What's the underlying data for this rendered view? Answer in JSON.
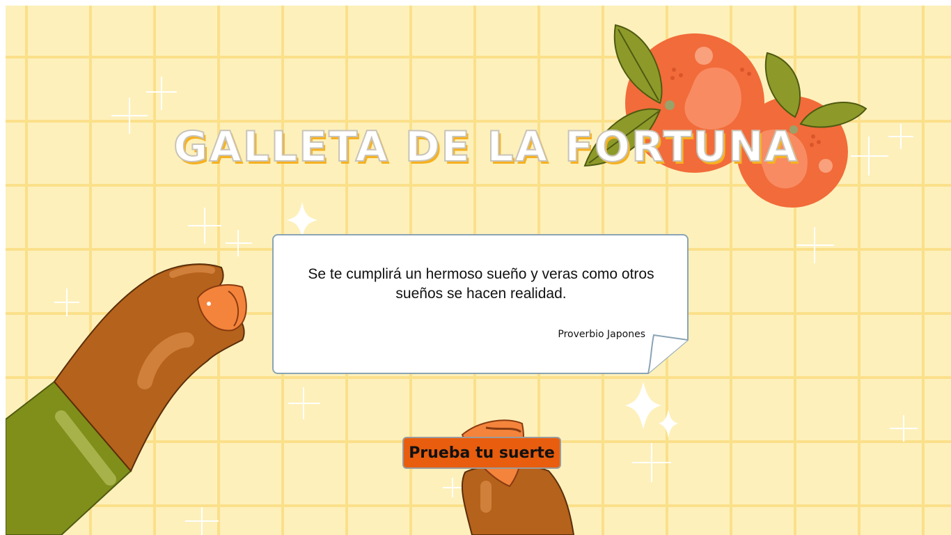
{
  "page": {
    "title": "GALLETA DE LA FORTUNA",
    "fortune": {
      "quote": "Se te cumplirá un hermoso sueño y veras como otros sueños se hacen realidad.",
      "author": "Proverbio Japones"
    },
    "button_label": "Prueba tu suerte"
  },
  "colors": {
    "background": "#fdf0bb",
    "grid": "#fbe08a",
    "button": "#e85d0e",
    "orange": "#f26b3a",
    "leaf": "#8d9a2a",
    "skin": "#b5621c",
    "sleeve": "#7f8f1a"
  },
  "icons": [
    "sparkle-icon",
    "orange-fruit-icon",
    "hand-icon",
    "fortune-cookie-icon"
  ]
}
